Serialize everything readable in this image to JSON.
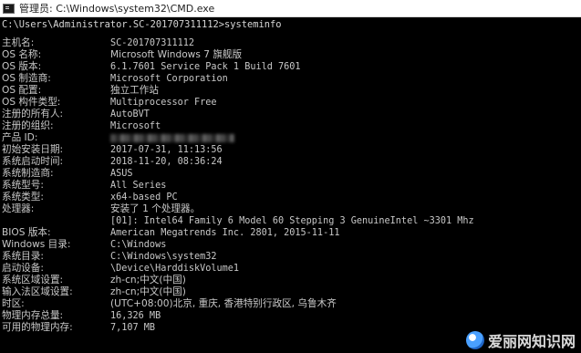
{
  "window": {
    "title": "管理员: C:\\Windows\\system32\\CMD.exe",
    "icon": "cmd-icon"
  },
  "console": {
    "prompt_line": "C:\\Users\\Administrator.SC-201707311112>systeminfo",
    "rows": [
      {
        "label": "主机名:",
        "value": "SC-201707311112"
      },
      {
        "label": "OS 名称:",
        "value": "Microsoft Windows 7 旗舰版"
      },
      {
        "label": "OS 版本:",
        "value": "6.1.7601 Service Pack 1 Build 7601"
      },
      {
        "label": "OS 制造商:",
        "value": "Microsoft Corporation"
      },
      {
        "label": "OS 配置:",
        "value": "独立工作站"
      },
      {
        "label": "OS 构件类型:",
        "value": "Multiprocessor Free"
      },
      {
        "label": "注册的所有人:",
        "value": "AutoBVT"
      },
      {
        "label": "注册的组织:",
        "value": "Microsoft"
      },
      {
        "label": "产品 ID:",
        "value": ""
      },
      {
        "label": "初始安装日期:",
        "value": "2017-07-31, 11:13:56"
      },
      {
        "label": "系统启动时间:",
        "value": "2018-11-20, 08:36:24"
      },
      {
        "label": "系统制造商:",
        "value": "ASUS"
      },
      {
        "label": "系统型号:",
        "value": "All Series"
      },
      {
        "label": "系统类型:",
        "value": "x64-based PC"
      },
      {
        "label": "处理器:",
        "value": "安装了 1 个处理器。"
      },
      {
        "label": "",
        "value": "[01]: Intel64 Family 6 Model 60 Stepping 3 GenuineIntel ~3301 Mhz"
      },
      {
        "label": "BIOS 版本:",
        "value": "American Megatrends Inc. 2801, 2015-11-11"
      },
      {
        "label": "Windows 目录:",
        "value": "C:\\Windows"
      },
      {
        "label": "系统目录:",
        "value": "C:\\Windows\\system32"
      },
      {
        "label": "启动设备:",
        "value": "\\Device\\HarddiskVolume1"
      },
      {
        "label": "系统区域设置:",
        "value": "zh-cn;中文(中国)"
      },
      {
        "label": "输入法区域设置:",
        "value": "zh-cn;中文(中国)"
      },
      {
        "label": "时区:",
        "value": "(UTC+08:00)北京, 重庆, 香港特别行政区, 乌鲁木齐"
      },
      {
        "label": "物理内存总量:",
        "value": "16,326 MB"
      },
      {
        "label": "可用的物理内存:",
        "value": "7,107 MB"
      }
    ]
  },
  "watermark": {
    "text": "爱丽网知识网"
  }
}
